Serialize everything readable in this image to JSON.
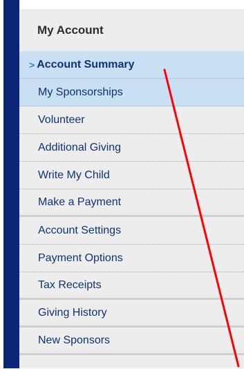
{
  "sidebar": {
    "title": "My Account",
    "active_marker": ">",
    "items": [
      {
        "label": "Account Summary",
        "active": true,
        "highlighted": true
      },
      {
        "label": "My Sponsorships",
        "active": false,
        "highlighted": true
      },
      {
        "label": "Volunteer",
        "active": false,
        "highlighted": false
      },
      {
        "label": "Additional Giving",
        "active": false,
        "highlighted": false
      },
      {
        "label": "Write My Child",
        "active": false,
        "highlighted": false
      },
      {
        "label": "Make a Payment",
        "active": false,
        "highlighted": false
      },
      {
        "label": "Account Settings",
        "active": false,
        "highlighted": false
      },
      {
        "label": "Payment Options",
        "active": false,
        "highlighted": false
      },
      {
        "label": "Tax Receipts",
        "active": false,
        "highlighted": false
      },
      {
        "label": "Giving History",
        "active": false,
        "highlighted": false
      },
      {
        "label": "New Sponsors",
        "active": false,
        "highlighted": false
      }
    ]
  },
  "colors": {
    "left_bar": "#0b2577",
    "nav_background": "#ededed",
    "highlight": "#c9dff4",
    "link_text": "#0f3272",
    "active_marker": "#2a86d1",
    "annotation_arrow": "#ff0000"
  }
}
